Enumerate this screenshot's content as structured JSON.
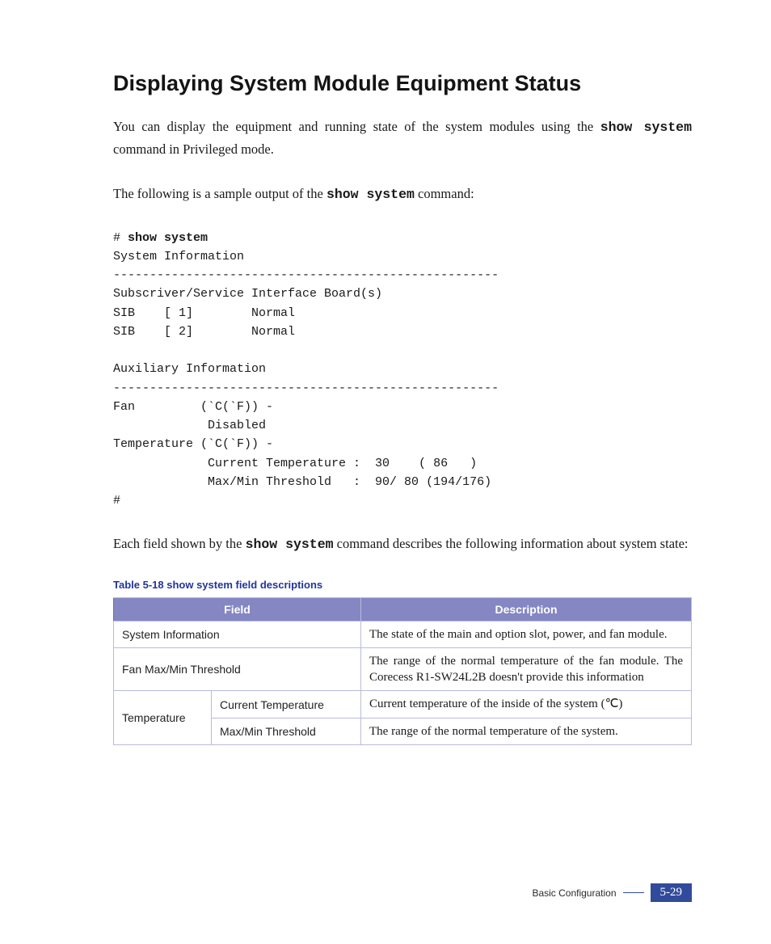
{
  "heading": "Displaying System Module Equipment Status",
  "intro": {
    "pre1": "You can display the equipment and running state of the system modules using ",
    "the": "the ",
    "cmd": "show system",
    "post1": " command in Privileged mode."
  },
  "sample_line": {
    "pre": "The following is a sample output of the ",
    "cmd": "show system",
    "post": " command:"
  },
  "code": {
    "hash": "# ",
    "show_sys": "show system",
    "l1": "System Information",
    "l2": "-----------------------------------------------------",
    "l3": "Subscriver/Service Interface Board(s)",
    "l4": "SIB    [ 1]        Normal",
    "l5": "SIB    [ 2]        Normal",
    "blank": " ",
    "l6": "Auxiliary Information",
    "l7": "-----------------------------------------------------",
    "l8": "Fan         (`C(`F)) -",
    "l9": "             Disabled",
    "l10": "Temperature (`C(`F)) -",
    "l11": "             Current Temperature :  30    ( 86   )",
    "l12": "             Max/Min Threshold   :  90/ 80 (194/176)",
    "l13": "#"
  },
  "each_field": {
    "pre": "Each field shown by the ",
    "cmd": "show system",
    "post": " command describes the following information about system state:"
  },
  "table_caption": "Table 5-18    show system field descriptions",
  "table": {
    "header_field": "Field",
    "header_desc": "Description",
    "rows": [
      {
        "field": "System Information",
        "desc": "The state of the main and option slot, power, and fan module."
      },
      {
        "field": "Fan Max/Min Threshold",
        "desc": "The range of the normal temperature of the fan module. The Corecess R1-SW24L2B doesn't provide this information"
      },
      {
        "field_group": "Temperature",
        "sub": "Current Temperature",
        "desc": "Current temperature of the inside of the system (℃)"
      },
      {
        "sub": "Max/Min Threshold",
        "desc": "The range of the normal temperature of the system."
      }
    ]
  },
  "footer": {
    "label": "Basic Configuration",
    "page": "5-29"
  }
}
